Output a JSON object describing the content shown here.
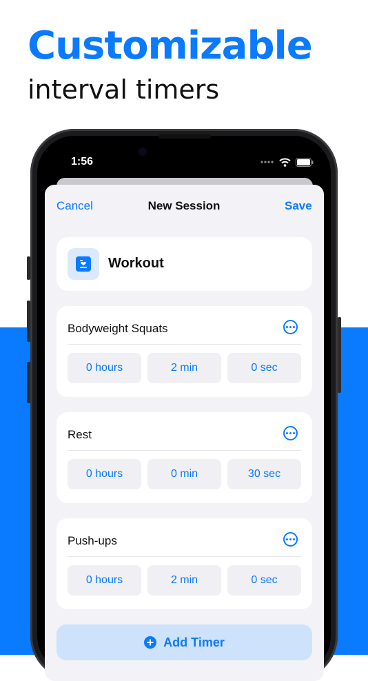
{
  "promo": {
    "headline": "Customizable",
    "subhead": "interval timers"
  },
  "status_bar": {
    "time": "1:56",
    "icons": [
      "signal-dots-icon",
      "wifi-icon",
      "battery-icon"
    ]
  },
  "nav": {
    "cancel_label": "Cancel",
    "title": "New Session",
    "save_label": "Save"
  },
  "session": {
    "icon": "workout-list-icon",
    "name": "Workout"
  },
  "timers": [
    {
      "name": "Bodyweight Squats",
      "hours": "0 hours",
      "minutes": "2 min",
      "seconds": "0 sec"
    },
    {
      "name": "Rest",
      "hours": "0 hours",
      "minutes": "0 min",
      "seconds": "30 sec"
    },
    {
      "name": "Push-ups",
      "hours": "0 hours",
      "minutes": "2 min",
      "seconds": "0 sec"
    }
  ],
  "add_timer_label": "Add Timer",
  "colors": {
    "accent": "#0a7aff",
    "sheet_background": "#f2f2f7",
    "card_background": "#ffffff"
  }
}
